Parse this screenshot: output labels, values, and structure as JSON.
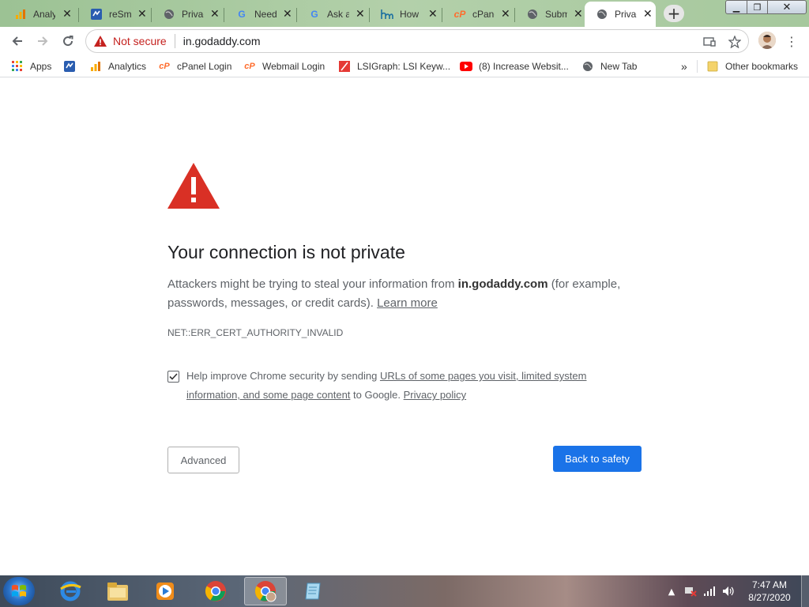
{
  "tabs": [
    {
      "title": "Analytics",
      "icon": "analytics-icon",
      "active": false
    },
    {
      "title": "reSmush",
      "icon": "resmush-icon",
      "active": false
    },
    {
      "title": "Privacy error",
      "icon": "globe-icon",
      "active": false
    },
    {
      "title": "Need",
      "icon": "google-icon",
      "active": false
    },
    {
      "title": "Ask a",
      "icon": "google-icon",
      "active": false
    },
    {
      "title": "How",
      "icon": "hm-icon",
      "active": false
    },
    {
      "title": "cPanel",
      "icon": "cpanel-icon",
      "active": false
    },
    {
      "title": "Submit",
      "icon": "globe-icon",
      "active": false
    },
    {
      "title": "Privacy error",
      "icon": "globe-icon",
      "active": true
    }
  ],
  "window_controls": [
    "minimize",
    "restore",
    "close"
  ],
  "omnibox": {
    "security_label": "Not secure",
    "url": "in.godaddy.com"
  },
  "bookmarks": [
    {
      "label": "Apps",
      "icon": "apps-grid-icon"
    },
    {
      "label": "",
      "icon": "resmush-icon"
    },
    {
      "label": "Analytics",
      "icon": "analytics-icon"
    },
    {
      "label": "cPanel Login",
      "icon": "cpanel-icon"
    },
    {
      "label": "Webmail Login",
      "icon": "cpanel-icon"
    },
    {
      "label": "LSIGraph: LSI Keyw...",
      "icon": "lsigraph-icon"
    },
    {
      "label": "(8) Increase Websit...",
      "icon": "youtube-icon"
    },
    {
      "label": "New Tab",
      "icon": "globe-icon"
    }
  ],
  "bookmarks_overflow": "»",
  "other_bookmarks": "Other bookmarks",
  "interstitial": {
    "heading": "Your connection is not private",
    "para_prefix": "Attackers might be trying to steal your information from ",
    "para_domain": "in.godaddy.com",
    "para_suffix": " (for example, passwords, messages, or credit cards). ",
    "learn_more": "Learn more",
    "error_code": "NET::ERR_CERT_AUTHORITY_INVALID",
    "checkbox_checked": true,
    "check_prefix": "Help improve Chrome security by sending ",
    "check_link": "URLs of some pages you visit, limited system information, and some page content",
    "check_mid": " to Google. ",
    "privacy_policy": "Privacy policy",
    "advanced_label": "Advanced",
    "safety_label": "Back to safety"
  },
  "taskbar": {
    "apps": [
      "internet-explorer-icon",
      "file-explorer-icon",
      "media-player-icon",
      "chrome-icon",
      "chrome-profile-icon",
      "notepad-icon"
    ],
    "active_app": "chrome-profile-icon",
    "time": "7:47 AM",
    "date": "8/27/2020"
  },
  "colors": {
    "warning_red": "#d93025",
    "primary_blue": "#1a73e8",
    "text_gray": "#5f6368"
  }
}
